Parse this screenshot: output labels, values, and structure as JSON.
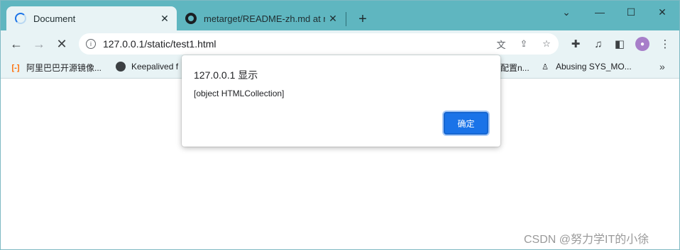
{
  "tabs": [
    {
      "title": "Document",
      "active": true
    },
    {
      "title": "metarget/README-zh.md at m",
      "active": false
    }
  ],
  "window_controls": {
    "minimize": "—",
    "maximize": "☐",
    "close": "✕",
    "dropdown": "⌄"
  },
  "toolbar": {
    "url": "127.0.0.1/static/test1.html",
    "back": "←",
    "forward": "→",
    "stop": "✕"
  },
  "bookmarks": [
    {
      "label": "阿里巴巴开源镜像...",
      "icon": "aliyun-icon"
    },
    {
      "label": "Keepalived f",
      "icon": "globe-icon"
    },
    {
      "label": "配置n...",
      "icon": "bookmark-icon"
    },
    {
      "label": "Abusing SYS_MO...",
      "icon": "person-icon"
    }
  ],
  "dialog": {
    "title": "127.0.0.1 显示",
    "message": "[object HTMLCollection]",
    "ok_label": "确定"
  },
  "watermark": "CSDN @努力学IT的小徐",
  "colors": {
    "tabstrip": "#5fb6c0",
    "toolbar": "#e8f3f5",
    "accent": "#1a73e8"
  }
}
